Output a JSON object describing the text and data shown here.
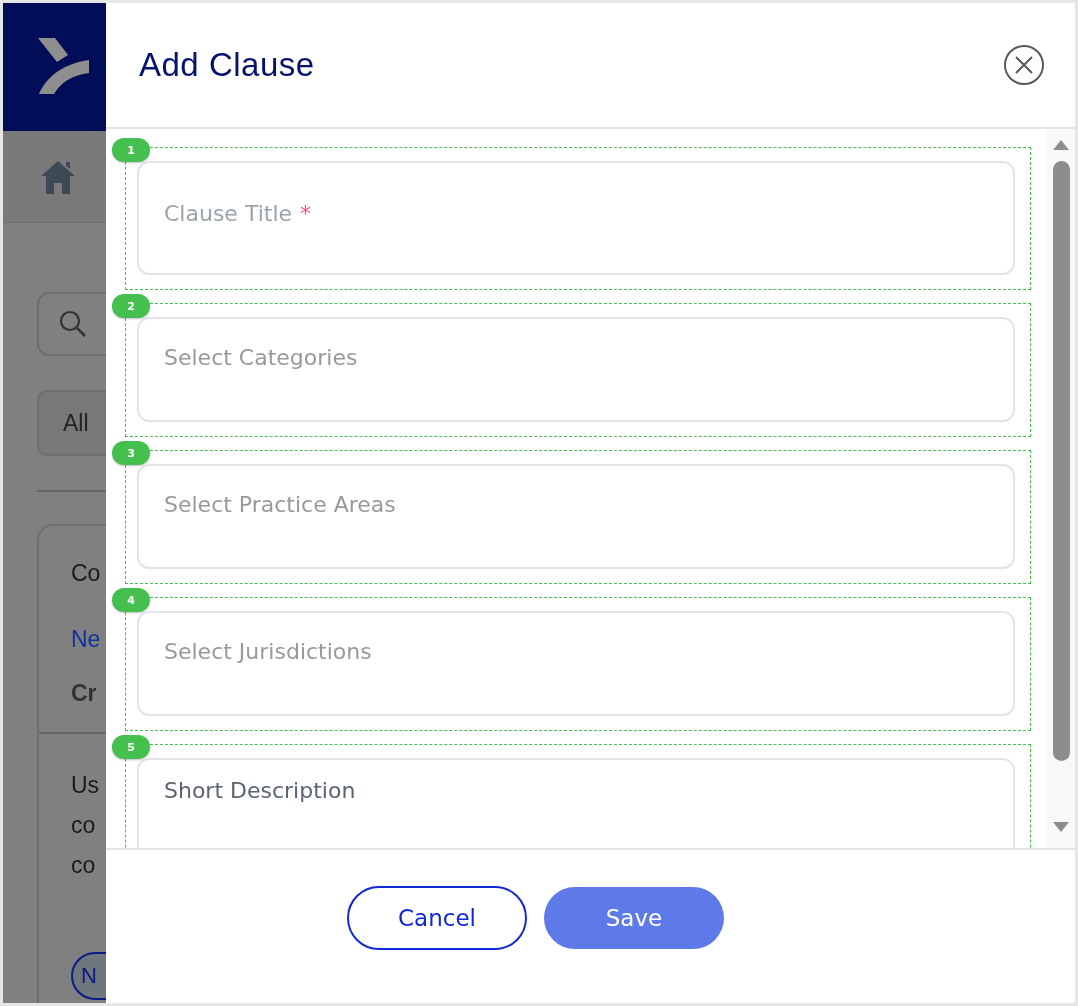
{
  "background": {
    "filter_button": "All",
    "card": {
      "title": "Co",
      "link": "Ne",
      "subtitle": "Cr",
      "body_lines": [
        "Us",
        "co",
        "co"
      ],
      "tag": "N"
    }
  },
  "dialog": {
    "title": "Add Clause",
    "fields": [
      {
        "number": "1",
        "kind": "text",
        "placeholder": "Clause Title",
        "required_mark": "*"
      },
      {
        "number": "2",
        "kind": "select",
        "placeholder": "Select Categories"
      },
      {
        "number": "3",
        "kind": "select",
        "placeholder": "Select Practice Areas"
      },
      {
        "number": "4",
        "kind": "select",
        "placeholder": "Select Jurisdictions"
      },
      {
        "number": "5",
        "kind": "textarea",
        "placeholder": "Short Description"
      }
    ],
    "buttons": [
      {
        "label": "Cancel",
        "kind": "secondary"
      },
      {
        "label": "Save",
        "kind": "primary"
      }
    ]
  }
}
